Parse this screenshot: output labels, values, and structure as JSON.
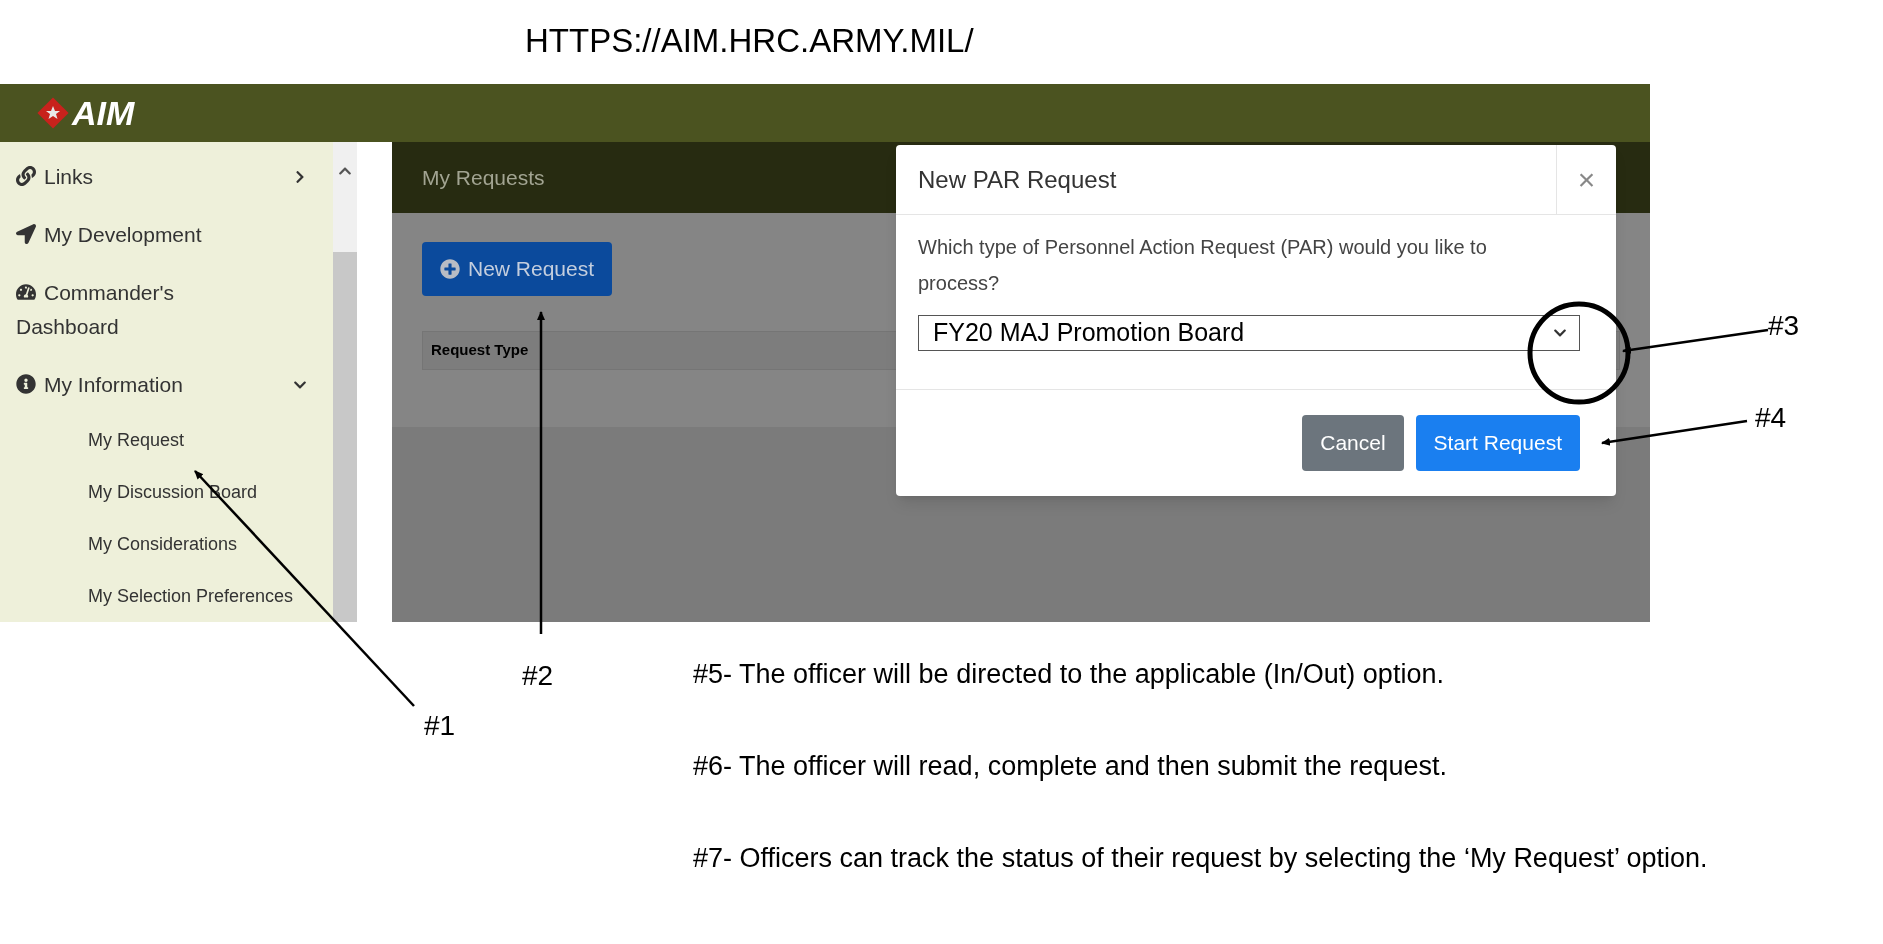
{
  "url": "HTTPS://AIM.HRC.ARMY.MIL/",
  "header": {
    "logo": "AIM"
  },
  "sidebar": {
    "items": [
      {
        "label": "Links",
        "kind": "group",
        "expanded": false
      },
      {
        "label": "My Development",
        "kind": "link"
      },
      {
        "label": "Commander's Dashboard",
        "kind": "link"
      },
      {
        "label": "My Information",
        "kind": "group",
        "expanded": true,
        "children": [
          {
            "label": "My Request"
          },
          {
            "label": "My Discussion Board"
          },
          {
            "label": "My Considerations"
          },
          {
            "label": "My Selection Preferences"
          }
        ]
      }
    ]
  },
  "main": {
    "title": "My Requests",
    "new_button": "New Request",
    "table": {
      "columns": [
        "Request Type"
      ]
    }
  },
  "modal": {
    "title": "New PAR Request",
    "close": "×",
    "question": "Which type of Personnel Action Request (PAR) would you like to process?",
    "select": {
      "value": "FY20 MAJ Promotion Board"
    },
    "buttons": [
      {
        "label": "Cancel",
        "kind": "secondary"
      },
      {
        "label": "Start Request",
        "kind": "primary"
      }
    ]
  },
  "annotations": {
    "labels": [
      "#1",
      "#2",
      "#3",
      "#4"
    ],
    "notes": [
      "#5- The officer will be directed to the applicable (In/Out) option.",
      "#6- The officer will read, complete and then submit the request.",
      "#7-  Officers can track the status of their request by selecting the ‘My Request’ option."
    ]
  }
}
